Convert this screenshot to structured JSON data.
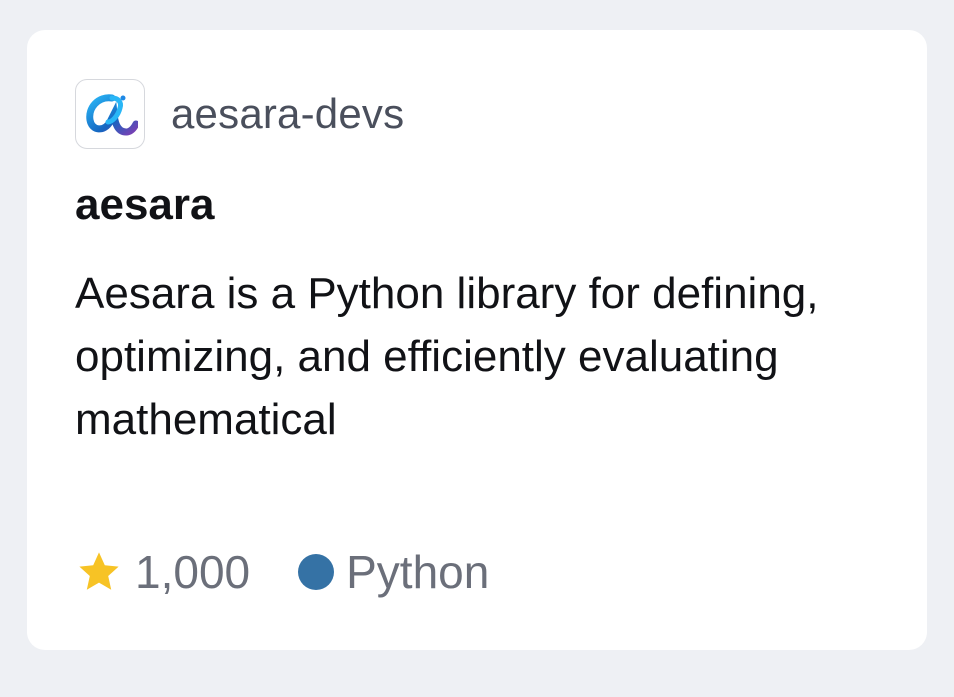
{
  "repo_card": {
    "owner": "aesara-devs",
    "owner_avatar_icon": "aesara-logo-icon",
    "name": "aesara",
    "description": "Aesara is a Python library for defining, optimizing, and efficiently evaluating mathematical",
    "stars": "1,000",
    "star_icon": "star-icon",
    "star_color": "#f7c325",
    "language": "Python",
    "language_color": "#3572A5"
  },
  "colors": {
    "page_background": "#eef0f4",
    "card_background": "#ffffff",
    "owner_text": "#4a4f5c",
    "primary_text": "#111216",
    "meta_text": "#6b6f7a"
  }
}
